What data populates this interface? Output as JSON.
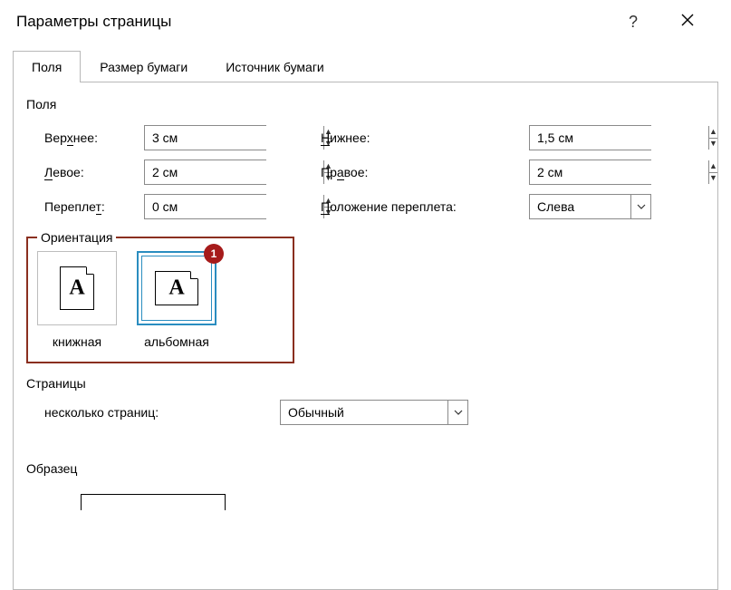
{
  "dialog": {
    "title": "Параметры страницы",
    "help": "?",
    "close": "✕"
  },
  "tabs": {
    "margins": "Поля",
    "paper": "Размер бумаги",
    "source": "Источник бумаги"
  },
  "margins": {
    "section_label": "Поля",
    "top_label_pre": "Вер",
    "top_label_u": "х",
    "top_label_post": "нее:",
    "top_value": "3 см",
    "bottom_label_u": "Н",
    "bottom_label_post": "ижнее:",
    "bottom_value": "1,5 см",
    "left_label_u": "Л",
    "left_label_post": "евое:",
    "left_value": "2 см",
    "right_label_pre": "Пр",
    "right_label_u": "а",
    "right_label_post": "вое:",
    "right_value": "2 см",
    "gutter_label_pre": "Перепле",
    "gutter_label_u": "т",
    "gutter_label_post": ":",
    "gutter_value": "0 см",
    "gutter_pos_label_u": "П",
    "gutter_pos_label_post": "оложение переплета:",
    "gutter_pos_value": "Слева"
  },
  "orientation": {
    "section_label": "Ориентация",
    "portrait_pre": "",
    "portrait_u": "к",
    "portrait_post": "нижная",
    "landscape_pre": "а",
    "landscape_u": "л",
    "landscape_post": "ьбомная",
    "badge": "1"
  },
  "pages": {
    "section_label": "Страницы",
    "multi_label_pre": "не",
    "multi_label_u": "с",
    "multi_label_post": "колько страниц:",
    "multi_value": "Обычный"
  },
  "sample": {
    "section_label": "Образец"
  }
}
